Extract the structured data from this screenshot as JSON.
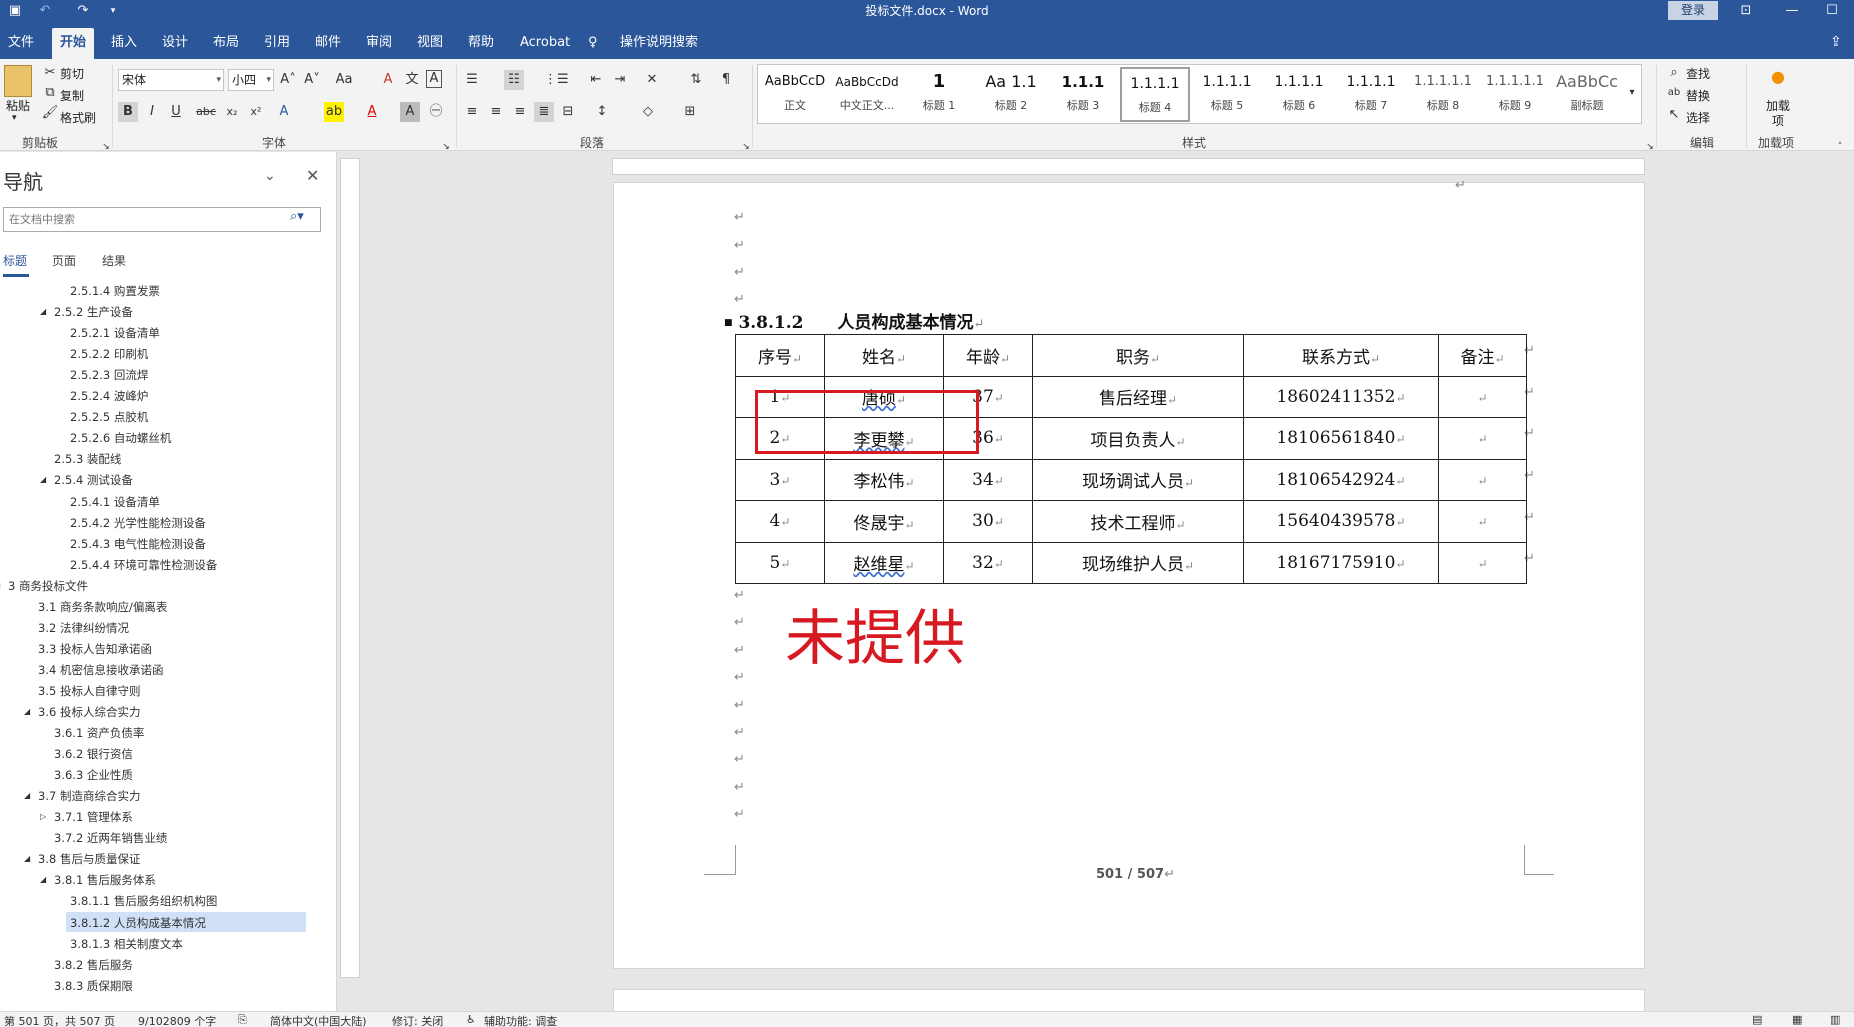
{
  "window": {
    "title": "投标文件.docx - Word",
    "login": "登录",
    "share_icon": "share-icon"
  },
  "tabs": [
    "文件",
    "开始",
    "插入",
    "设计",
    "布局",
    "引用",
    "邮件",
    "审阅",
    "视图",
    "帮助",
    "Acrobat"
  ],
  "tell_me": "操作说明搜索",
  "ribbon": {
    "clipboard": {
      "paste": "粘贴",
      "cut": "剪切",
      "copy": "复制",
      "format_painter": "格式刷",
      "group": "剪贴板"
    },
    "font": {
      "name": "宋体",
      "size": "小四",
      "group": "字体"
    },
    "paragraph": {
      "group": "段落"
    },
    "styles": {
      "group": "样式",
      "items": [
        {
          "preview": "AaBbCcD",
          "name": "正文"
        },
        {
          "preview": "AaBbCcDd",
          "name": "中文正文..."
        },
        {
          "preview": "1",
          "name": "标题 1"
        },
        {
          "preview": "Aa 1.1",
          "name": "标题 2"
        },
        {
          "preview": "1.1.1",
          "name": "标题 3"
        },
        {
          "preview": "1.1.1.1",
          "name": "标题 4"
        },
        {
          "preview": "1.1.1.1",
          "name": "标题 5"
        },
        {
          "preview": "1.1.1.1",
          "name": "标题 6"
        },
        {
          "preview": "1.1.1.1",
          "name": "标题 7"
        },
        {
          "preview": "1.1.1.1.1",
          "name": "标题 8"
        },
        {
          "preview": "1.1.1.1.1",
          "name": "标题 9"
        },
        {
          "preview": "AaBbCc",
          "name": "副标题"
        }
      ]
    },
    "editing": {
      "find": "查找",
      "replace": "替换",
      "select": "选择",
      "group": "编辑"
    },
    "addins": {
      "label": "加载项",
      "group": "加载项"
    }
  },
  "nav": {
    "title": "导航",
    "search_placeholder": "在文档中搜索",
    "tabs": [
      "标题",
      "页面",
      "结果"
    ],
    "items": [
      "2.5.1.4 购置发票",
      "2.5.2 生产设备",
      "2.5.2.1 设备清单",
      "2.5.2.2 印刷机",
      "2.5.2.3 回流焊",
      "2.5.2.4 波峰炉",
      "2.5.2.5 点胶机",
      "2.5.2.6 自动螺丝机",
      "2.5.3 装配线",
      "2.5.4 测试设备",
      "2.5.4.1 设备清单",
      "2.5.4.2 光学性能检测设备",
      "2.5.4.3 电气性能检测设备",
      "2.5.4.4 环境可靠性检测设备",
      "3 商务投标文件",
      "3.1 商务条款响应/偏离表",
      "3.2 法律纠纷情况",
      "3.3 投标人告知承诺函",
      "3.4 机密信息接收承诺函",
      "3.5 投标人自律守则",
      "3.6 投标人综合实力",
      "3.6.1 资产负债率",
      "3.6.2 银行资信",
      "3.6.3 企业性质",
      "3.7 制造商综合实力",
      "3.7.1 管理体系",
      "3.7.2 近两年销售业绩",
      "3.8 售后与质量保证",
      "3.8.1 售后服务体系",
      "3.8.1.1 售后服务组织机构图",
      "3.8.1.2 人员构成基本情况",
      "3.8.1.3 相关制度文本",
      "3.8.2 售后服务",
      "3.8.3 质保期限"
    ]
  },
  "document": {
    "heading": "3.8.1.2　　人员构成基本情况",
    "table": {
      "headers": [
        "序号",
        "姓名",
        "年龄",
        "职务",
        "联系方式",
        "备注"
      ],
      "rows": [
        [
          "1",
          "唐硕",
          "37",
          "售后经理",
          "18602411352",
          ""
        ],
        [
          "2",
          "李更攀",
          "36",
          "项目负责人",
          "18106561840",
          ""
        ],
        [
          "3",
          "李松伟",
          "34",
          "现场调试人员",
          "18106542924",
          ""
        ],
        [
          "4",
          "佟晟宇",
          "30",
          "技术工程师",
          "15640439578",
          ""
        ],
        [
          "5",
          "赵维星",
          "32",
          "现场维护人员",
          "18167175910",
          ""
        ]
      ]
    },
    "annotation": "未提供",
    "page_number": "501 / 507"
  },
  "status": {
    "page": "第 501 页，共 507 页",
    "words": "9/102809 个字",
    "language": "简体中文(中国大陆)",
    "track": "修订: 关闭",
    "accessibility": "辅助功能: 调查"
  }
}
